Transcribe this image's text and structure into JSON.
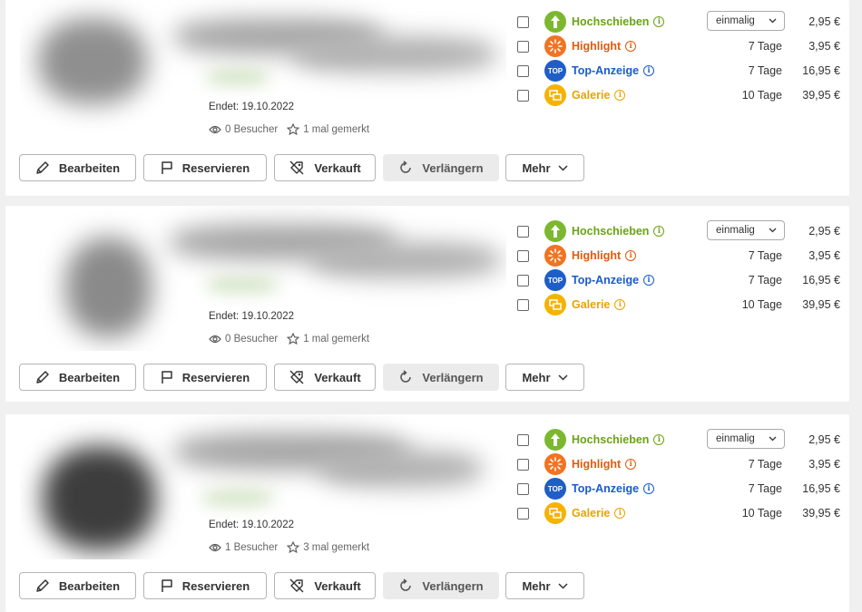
{
  "listings": [
    {
      "ends": "Endet: 19.10.2022",
      "visitors": "0 Besucher",
      "saved": "1 mal gemerkt"
    },
    {
      "ends": "Endet: 19.10.2022",
      "visitors": "0 Besucher",
      "saved": "1 mal gemerkt"
    },
    {
      "ends": "Endet: 19.10.2022",
      "visitors": "1 Besucher",
      "saved": "3 mal gemerkt"
    }
  ],
  "features": {
    "hochschieben": {
      "label": "Hochschieben",
      "select_value": "einmalig",
      "price": "2,95 €",
      "color": "#6aa313",
      "icon": "arrow-up-icon"
    },
    "highlight": {
      "label": "Highlight",
      "duration": "7 Tage",
      "price": "3,95 €",
      "color": "#e15a0a",
      "icon": "sparkle-icon"
    },
    "top": {
      "label": "Top-Anzeige",
      "duration": "7 Tage",
      "price": "16,95 €",
      "color": "#1a5bc9",
      "icon": "top-badge-icon",
      "badge": "TOP"
    },
    "galerie": {
      "label": "Galerie",
      "duration": "10 Tage",
      "price": "39,95 €",
      "color": "#e8a400",
      "icon": "gallery-icon"
    }
  },
  "actions": {
    "edit": "Bearbeiten",
    "reserve": "Reservieren",
    "sold": "Verkauft",
    "extend": "Verlängern",
    "more": "Mehr"
  }
}
